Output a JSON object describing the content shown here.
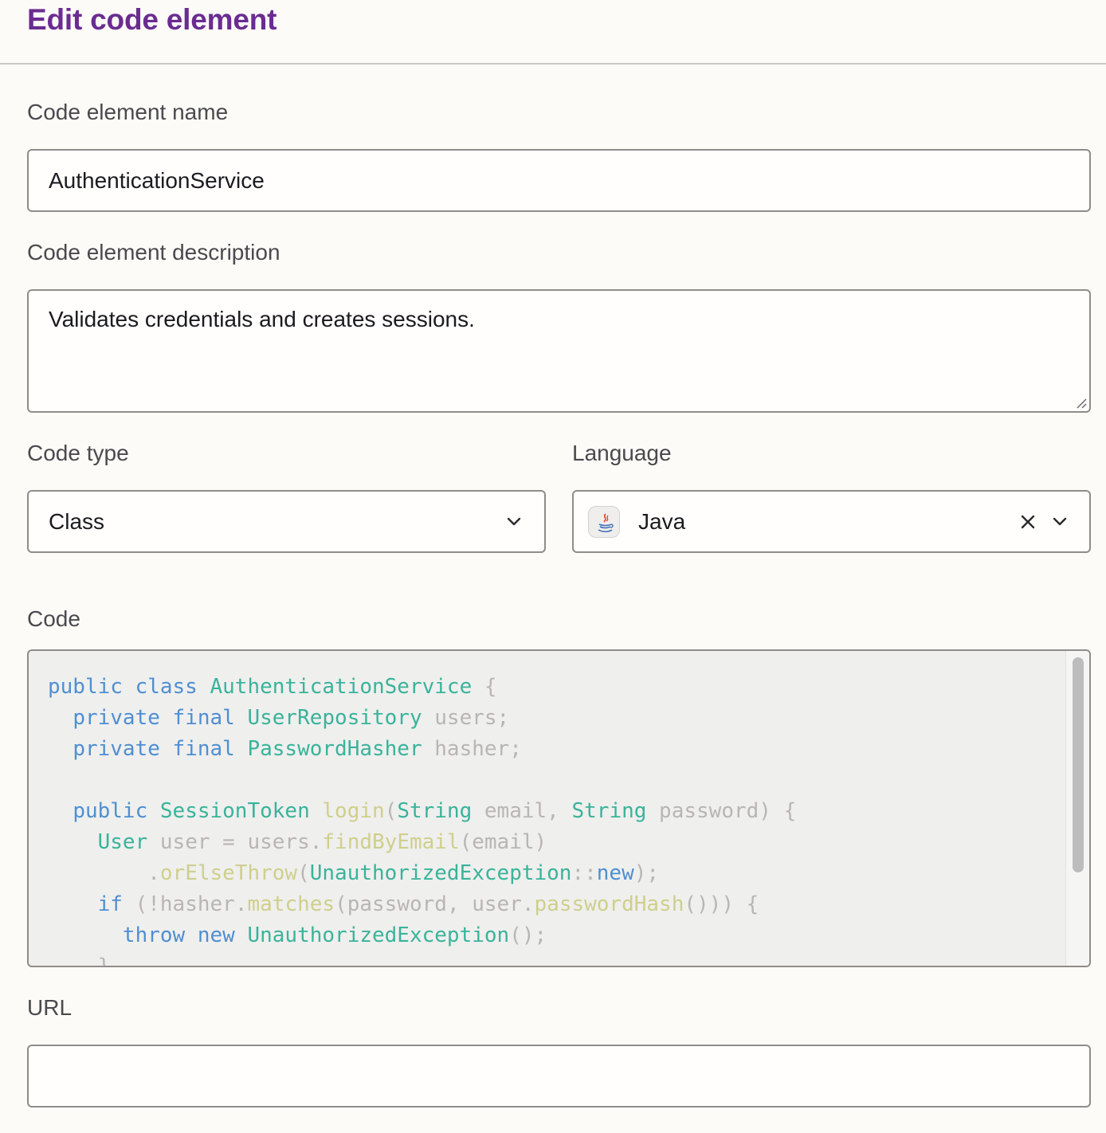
{
  "header": {
    "title": "Edit code element"
  },
  "name_field": {
    "label": "Code element name",
    "value": "AuthenticationService"
  },
  "description_field": {
    "label": "Code element description",
    "value": "Validates credentials and creates sessions."
  },
  "code_type": {
    "label": "Code type",
    "value": "Class"
  },
  "language": {
    "label": "Language",
    "value": "Java",
    "icon": "java-icon"
  },
  "code": {
    "label": "Code",
    "lines": [
      [
        {
          "t": "public class ",
          "c": "kw"
        },
        {
          "t": "AuthenticationService",
          "c": "type"
        },
        {
          "t": " {",
          "c": "plain"
        }
      ],
      [
        {
          "t": "  "
        },
        {
          "t": "private final ",
          "c": "kw"
        },
        {
          "t": "UserRepository",
          "c": "type"
        },
        {
          "t": " users;",
          "c": "plain"
        }
      ],
      [
        {
          "t": "  "
        },
        {
          "t": "private final ",
          "c": "kw"
        },
        {
          "t": "PasswordHasher",
          "c": "type"
        },
        {
          "t": " hasher;",
          "c": "plain"
        }
      ],
      [],
      [
        {
          "t": "  "
        },
        {
          "t": "public ",
          "c": "kw"
        },
        {
          "t": "SessionToken",
          "c": "type"
        },
        {
          "t": " ",
          "c": "plain"
        },
        {
          "t": "login",
          "c": "fn"
        },
        {
          "t": "(",
          "c": "plain"
        },
        {
          "t": "String",
          "c": "type"
        },
        {
          "t": " email, ",
          "c": "plain"
        },
        {
          "t": "String",
          "c": "type"
        },
        {
          "t": " password) {",
          "c": "plain"
        }
      ],
      [
        {
          "t": "    "
        },
        {
          "t": "User",
          "c": "type"
        },
        {
          "t": " user = users.",
          "c": "plain"
        },
        {
          "t": "findByEmail",
          "c": "fn"
        },
        {
          "t": "(email)",
          "c": "plain"
        }
      ],
      [
        {
          "t": "        "
        },
        {
          "t": ".",
          "c": "plain"
        },
        {
          "t": "orElseThrow",
          "c": "fn"
        },
        {
          "t": "(",
          "c": "plain"
        },
        {
          "t": "UnauthorizedException",
          "c": "type"
        },
        {
          "t": "::",
          "c": "plain"
        },
        {
          "t": "new",
          "c": "kw"
        },
        {
          "t": ");",
          "c": "plain"
        }
      ],
      [
        {
          "t": "    "
        },
        {
          "t": "if",
          "c": "kw"
        },
        {
          "t": " (!hasher.",
          "c": "plain"
        },
        {
          "t": "matches",
          "c": "fn"
        },
        {
          "t": "(password, user.",
          "c": "plain"
        },
        {
          "t": "passwordHash",
          "c": "fn"
        },
        {
          "t": "())) {",
          "c": "plain"
        }
      ],
      [
        {
          "t": "      "
        },
        {
          "t": "throw new ",
          "c": "kw"
        },
        {
          "t": "UnauthorizedException",
          "c": "type"
        },
        {
          "t": "();",
          "c": "plain"
        }
      ],
      [
        {
          "t": "    "
        },
        {
          "t": "}",
          "c": "plain"
        }
      ]
    ]
  },
  "url_field": {
    "label": "URL",
    "value": ""
  },
  "colors": {
    "title": "#6a2c91",
    "keyword": "#4f8fd1",
    "type": "#3ab39a",
    "function": "#cfcf8c",
    "plain": "#b7b6b3"
  }
}
